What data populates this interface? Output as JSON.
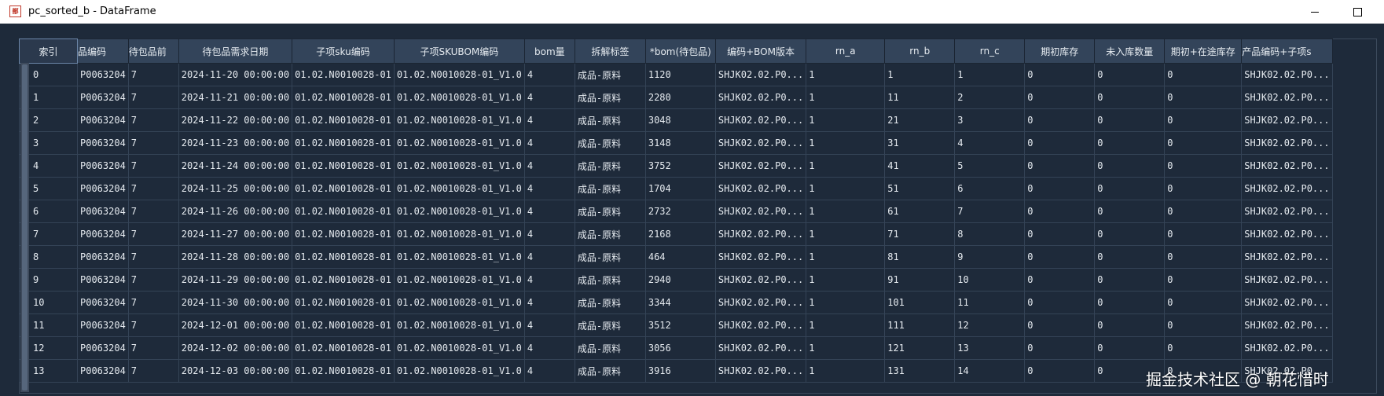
{
  "window": {
    "title": "pc_sorted_b - DataFrame",
    "app_icon_glyph": "鄯"
  },
  "table": {
    "columns": [
      "索引",
      "品编码",
      "待包品前",
      "待包品需求日期",
      "子项sku编码",
      "子项SKUBOM编码",
      "bom量",
      "拆解标签",
      "*bom(待包品)",
      "编码+BOM版本",
      "rn_a",
      "rn_b",
      "rn_c",
      "期初库存",
      "未入库数量",
      "期初+在途库存",
      "产品编码+子项s"
    ],
    "rows": [
      [
        "0",
        "P0063204",
        "7",
        "2024-11-20 00:00:00",
        "01.02.N0010028-01",
        "01.02.N0010028-01_V1.0",
        "4",
        "成品-原料",
        "1120",
        "SHJK02.02.P0...",
        "1",
        "1",
        "1",
        "0",
        "0",
        "0",
        "SHJK02.02.P0..."
      ],
      [
        "1",
        "P0063204",
        "7",
        "2024-11-21 00:00:00",
        "01.02.N0010028-01",
        "01.02.N0010028-01_V1.0",
        "4",
        "成品-原料",
        "2280",
        "SHJK02.02.P0...",
        "1",
        "11",
        "2",
        "0",
        "0",
        "0",
        "SHJK02.02.P0..."
      ],
      [
        "2",
        "P0063204",
        "7",
        "2024-11-22 00:00:00",
        "01.02.N0010028-01",
        "01.02.N0010028-01_V1.0",
        "4",
        "成品-原料",
        "3048",
        "SHJK02.02.P0...",
        "1",
        "21",
        "3",
        "0",
        "0",
        "0",
        "SHJK02.02.P0..."
      ],
      [
        "3",
        "P0063204",
        "7",
        "2024-11-23 00:00:00",
        "01.02.N0010028-01",
        "01.02.N0010028-01_V1.0",
        "4",
        "成品-原料",
        "3148",
        "SHJK02.02.P0...",
        "1",
        "31",
        "4",
        "0",
        "0",
        "0",
        "SHJK02.02.P0..."
      ],
      [
        "4",
        "P0063204",
        "7",
        "2024-11-24 00:00:00",
        "01.02.N0010028-01",
        "01.02.N0010028-01_V1.0",
        "4",
        "成品-原料",
        "3752",
        "SHJK02.02.P0...",
        "1",
        "41",
        "5",
        "0",
        "0",
        "0",
        "SHJK02.02.P0..."
      ],
      [
        "5",
        "P0063204",
        "7",
        "2024-11-25 00:00:00",
        "01.02.N0010028-01",
        "01.02.N0010028-01_V1.0",
        "4",
        "成品-原料",
        "1704",
        "SHJK02.02.P0...",
        "1",
        "51",
        "6",
        "0",
        "0",
        "0",
        "SHJK02.02.P0..."
      ],
      [
        "6",
        "P0063204",
        "7",
        "2024-11-26 00:00:00",
        "01.02.N0010028-01",
        "01.02.N0010028-01_V1.0",
        "4",
        "成品-原料",
        "2732",
        "SHJK02.02.P0...",
        "1",
        "61",
        "7",
        "0",
        "0",
        "0",
        "SHJK02.02.P0..."
      ],
      [
        "7",
        "P0063204",
        "7",
        "2024-11-27 00:00:00",
        "01.02.N0010028-01",
        "01.02.N0010028-01_V1.0",
        "4",
        "成品-原料",
        "2168",
        "SHJK02.02.P0...",
        "1",
        "71",
        "8",
        "0",
        "0",
        "0",
        "SHJK02.02.P0..."
      ],
      [
        "8",
        "P0063204",
        "7",
        "2024-11-28 00:00:00",
        "01.02.N0010028-01",
        "01.02.N0010028-01_V1.0",
        "4",
        "成品-原料",
        "464",
        "SHJK02.02.P0...",
        "1",
        "81",
        "9",
        "0",
        "0",
        "0",
        "SHJK02.02.P0..."
      ],
      [
        "9",
        "P0063204",
        "7",
        "2024-11-29 00:00:00",
        "01.02.N0010028-01",
        "01.02.N0010028-01_V1.0",
        "4",
        "成品-原料",
        "2940",
        "SHJK02.02.P0...",
        "1",
        "91",
        "10",
        "0",
        "0",
        "0",
        "SHJK02.02.P0..."
      ],
      [
        "10",
        "P0063204",
        "7",
        "2024-11-30 00:00:00",
        "01.02.N0010028-01",
        "01.02.N0010028-01_V1.0",
        "4",
        "成品-原料",
        "3344",
        "SHJK02.02.P0...",
        "1",
        "101",
        "11",
        "0",
        "0",
        "0",
        "SHJK02.02.P0..."
      ],
      [
        "11",
        "P0063204",
        "7",
        "2024-12-01 00:00:00",
        "01.02.N0010028-01",
        "01.02.N0010028-01_V1.0",
        "4",
        "成品-原料",
        "3512",
        "SHJK02.02.P0...",
        "1",
        "111",
        "12",
        "0",
        "0",
        "0",
        "SHJK02.02.P0..."
      ],
      [
        "12",
        "P0063204",
        "7",
        "2024-12-02 00:00:00",
        "01.02.N0010028-01",
        "01.02.N0010028-01_V1.0",
        "4",
        "成品-原料",
        "3056",
        "SHJK02.02.P0...",
        "1",
        "121",
        "13",
        "0",
        "0",
        "0",
        "SHJK02.02.P0..."
      ],
      [
        "13",
        "P0063204",
        "7",
        "2024-12-03 00:00:00",
        "01.02.N0010028-01",
        "01.02.N0010028-01_V1.0",
        "4",
        "成品-原料",
        "3916",
        "SHJK02.02.P0...",
        "1",
        "131",
        "14",
        "0",
        "0",
        "0",
        "SHJK02.02.P0..."
      ]
    ]
  },
  "watermark": "掘金技术社区 @ 朝花惜时",
  "colors": {
    "background": "#1e2a3a",
    "header": "#33445a",
    "grid": "#344356",
    "text": "#e6ebf0"
  }
}
